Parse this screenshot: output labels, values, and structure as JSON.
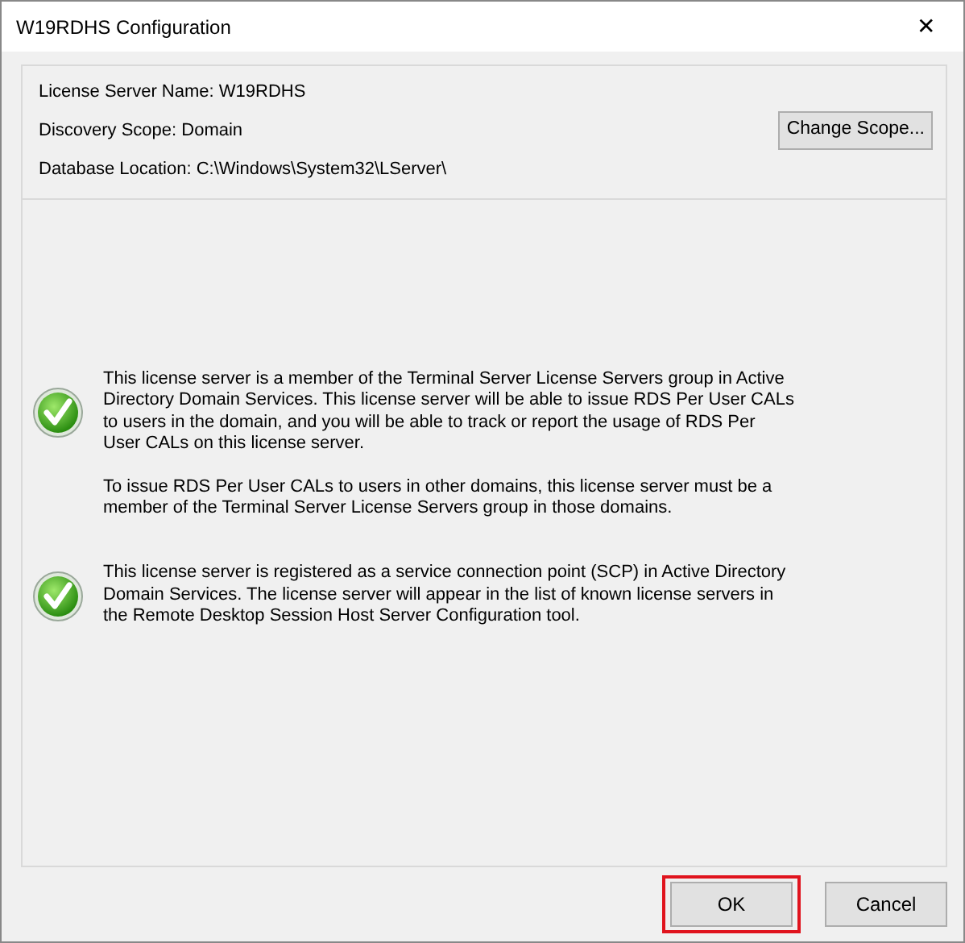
{
  "window": {
    "title": "W19RDHS Configuration",
    "close": "✕"
  },
  "info": [
    {
      "text": "License Server Name: W19RDHS"
    },
    {
      "text": "Discovery Scope: Domain",
      "button": "Change Scope..."
    },
    {
      "text": "Database Location: C:\\Windows\\System32\\LServer\\"
    }
  ],
  "messages": [
    {
      "kind": "success",
      "paragraphs": [
        [
          "This license server is a member of the Terminal Server License Servers group in Active",
          "Directory Domain Services. This license server will be able to issue RDS Per User CALs",
          "to users in the domain, and you will be able to track or report the usage of RDS Per",
          "User CALs on this license server."
        ],
        [
          "To issue RDS Per User CALs to users in other domains, this license server must be a",
          "member of the Terminal Server License Servers group in those domains."
        ]
      ]
    },
    {
      "kind": "success",
      "paragraphs": [
        [
          "This license server is registered as a service connection point (SCP) in Active Directory",
          "Domain Services. The license server will appear in the list of known license servers in",
          "the Remote Desktop Session Host Server Configuration tool."
        ]
      ]
    }
  ],
  "buttons": [
    {
      "label": "OK",
      "highlighted": true
    },
    {
      "label": "Cancel",
      "highlighted": false
    }
  ]
}
